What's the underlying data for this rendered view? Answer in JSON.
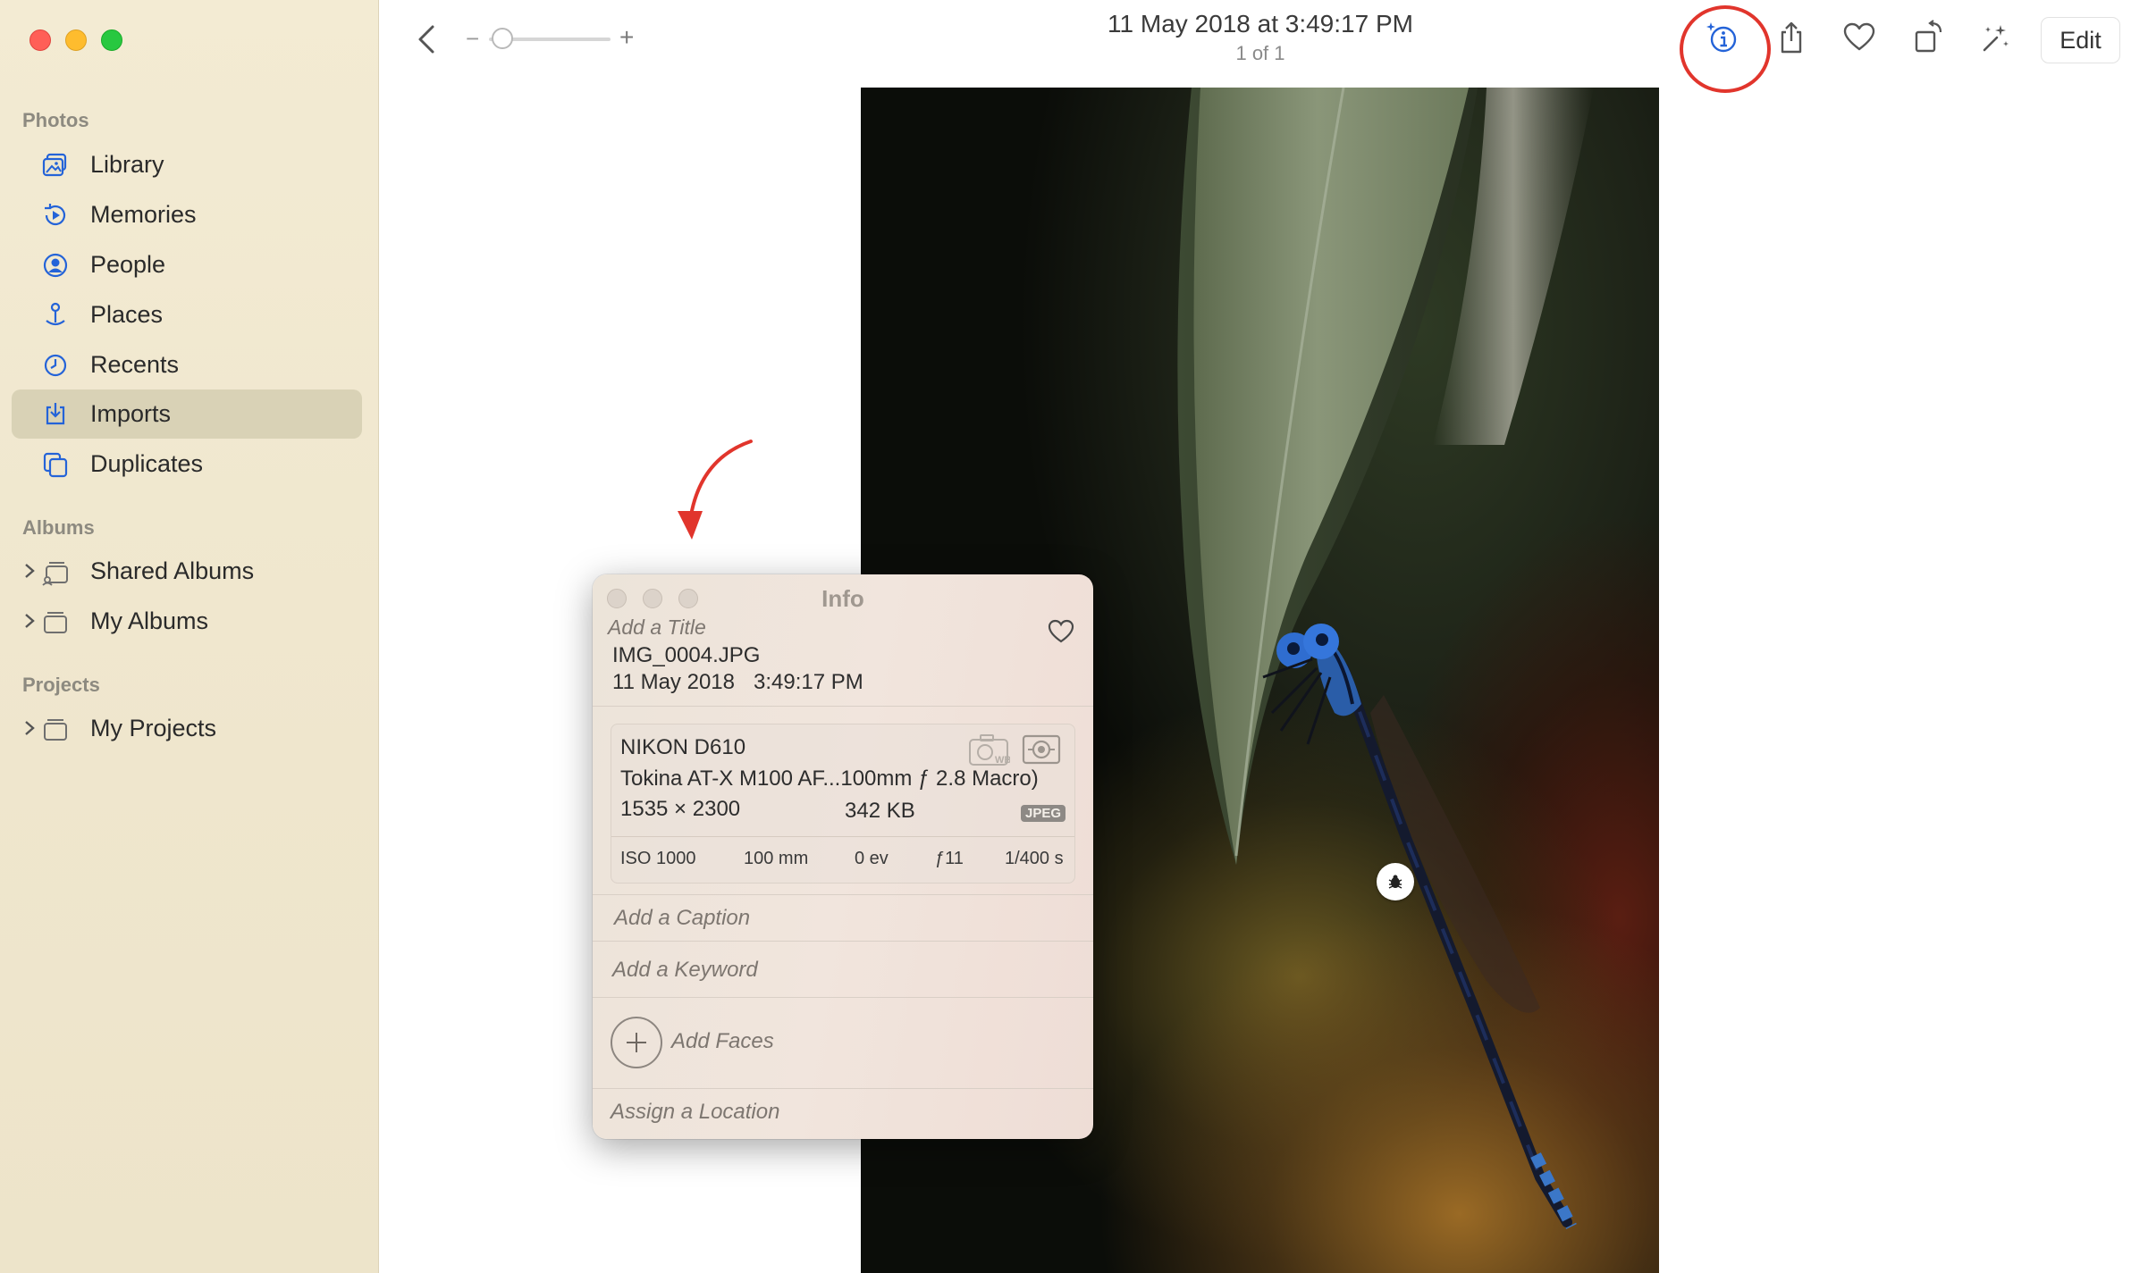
{
  "window": {
    "controls": [
      "close",
      "minimize",
      "zoom"
    ]
  },
  "sidebar": {
    "sections": [
      {
        "title": "Photos",
        "items": [
          {
            "label": "Library",
            "icon": "library-icon",
            "selected": false
          },
          {
            "label": "Memories",
            "icon": "memories-icon",
            "selected": false
          },
          {
            "label": "People",
            "icon": "people-icon",
            "selected": false
          },
          {
            "label": "Places",
            "icon": "places-icon",
            "selected": false
          },
          {
            "label": "Recents",
            "icon": "recents-icon",
            "selected": false
          },
          {
            "label": "Imports",
            "icon": "imports-icon",
            "selected": true
          },
          {
            "label": "Duplicates",
            "icon": "duplicates-icon",
            "selected": false
          }
        ]
      },
      {
        "title": "Albums",
        "items": [
          {
            "label": "Shared Albums",
            "icon": "shared-albums-icon",
            "expandable": true
          },
          {
            "label": "My Albums",
            "icon": "album-icon",
            "expandable": true
          }
        ]
      },
      {
        "title": "Projects",
        "items": [
          {
            "label": "My Projects",
            "icon": "projects-icon",
            "expandable": true
          }
        ]
      }
    ]
  },
  "toolbar": {
    "date_title": "11 May 2018 at 3:49:17 PM",
    "count": "1 of 1",
    "zoom_minus": "−",
    "zoom_plus": "+",
    "zoom_level": 0.05,
    "edit_label": "Edit",
    "icons": [
      "back-icon",
      "info-icon",
      "share-icon",
      "heart-icon",
      "rotate-icon",
      "magic-wand-icon"
    ]
  },
  "info_panel": {
    "title": "Info",
    "add_title_placeholder": "Add a Title",
    "filename": "IMG_0004.JPG",
    "date": "11 May 2018",
    "time": "3:49:17 PM",
    "camera": "NIKON D610",
    "lens": "Tokina AT-X M100 AF...100mm ƒ 2.8 Macro)",
    "dimensions": "1535 × 2300",
    "file_size": "342 KB",
    "format": "JPEG",
    "exif": {
      "iso": "ISO 1000",
      "focal_length": "100 mm",
      "exposure_bias": "0 ev",
      "aperture": "ƒ11",
      "shutter": "1/400 s"
    },
    "caption_placeholder": "Add a Caption",
    "keyword_placeholder": "Add a Keyword",
    "faces_label": "Add Faces",
    "location_placeholder": "Assign a Location"
  },
  "colors": {
    "sidebar_bg": "#f0e8cf",
    "selected_item": "#d9d2b6",
    "accent": "#2463d8",
    "annotation_red": "#e1352c"
  }
}
